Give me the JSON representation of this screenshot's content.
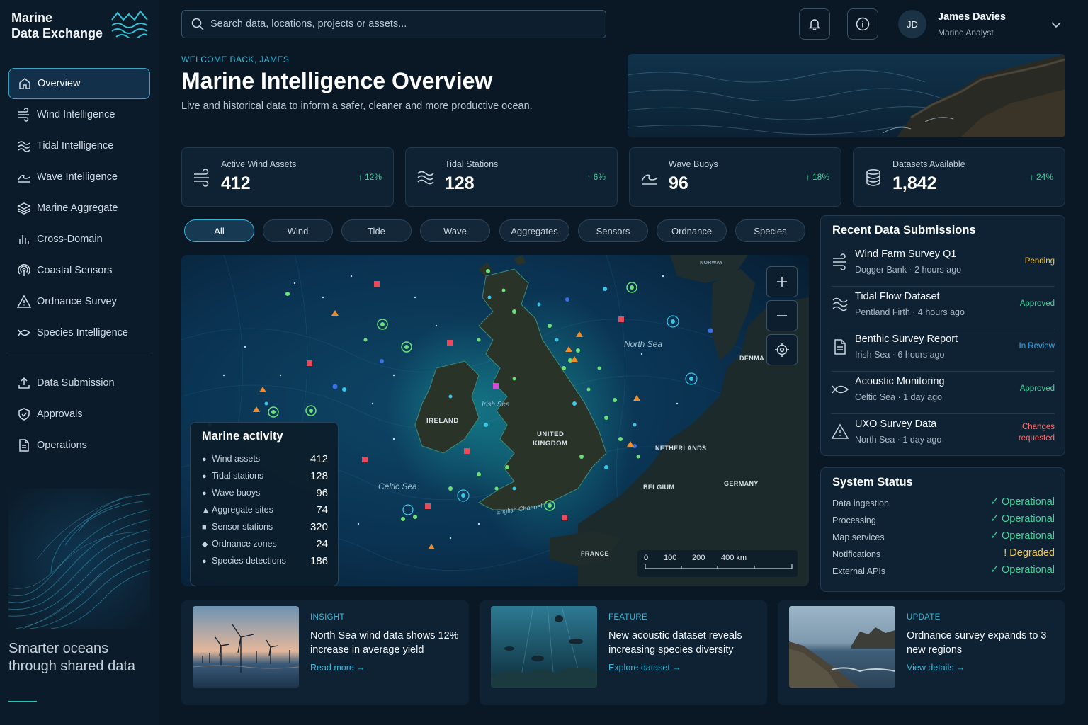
{
  "app": {
    "name_line1": "Marine",
    "name_line2": "Data Exchange"
  },
  "sidebar": {
    "items": [
      {
        "label": "Overview",
        "icon": "home-icon",
        "active": true
      },
      {
        "label": "Wind Intelligence",
        "icon": "wind-icon"
      },
      {
        "label": "Tidal Intelligence",
        "icon": "waves-icon"
      },
      {
        "label": "Wave Intelligence",
        "icon": "wave-icon"
      },
      {
        "label": "Marine Aggregate",
        "icon": "layers-icon"
      },
      {
        "label": "Cross-Domain",
        "icon": "bar-chart-icon"
      },
      {
        "label": "Coastal Sensors",
        "icon": "antenna-icon"
      },
      {
        "label": "Ordnance Survey",
        "icon": "warning-icon"
      },
      {
        "label": "Species Intelligence",
        "icon": "fish-icon"
      }
    ],
    "secondary": [
      {
        "label": "Data Submission",
        "icon": "upload-icon"
      },
      {
        "label": "Approvals",
        "icon": "shield-check-icon"
      },
      {
        "label": "Operations",
        "icon": "document-icon"
      }
    ],
    "tagline": "Smarter oceans through shared data"
  },
  "topbar": {
    "search_placeholder": "Search data, locations, projects or assets...",
    "user_initials": "JD",
    "user_name": "James Davies",
    "user_role": "Marine Analyst"
  },
  "hero": {
    "welcome": "WELCOME BACK, JAMES",
    "title": "Marine Intelligence Overview",
    "subtitle": "Live and historical data to inform a safer, cleaner and more productive ocean."
  },
  "stats": [
    {
      "label": "Active Wind Assets",
      "value": "412",
      "delta": "↑ 12%",
      "icon": "wind-icon"
    },
    {
      "label": "Tidal Stations",
      "value": "128",
      "delta": "↑ 6%",
      "icon": "waves-icon"
    },
    {
      "label": "Wave Buoys",
      "value": "96",
      "delta": "↑ 18%",
      "icon": "wave-icon"
    },
    {
      "label": "Datasets Available",
      "value": "1,842",
      "delta": "↑ 24%",
      "icon": "database-icon"
    }
  ],
  "filters": [
    "All",
    "Wind",
    "Tide",
    "Wave",
    "Aggregates",
    "Sensors",
    "Ordnance",
    "Species"
  ],
  "map": {
    "labels": {
      "north_sea": "North Sea",
      "irish_sea": "Irish Sea",
      "celtic_sea": "Celtic Sea",
      "english_channel": "English Channel",
      "ireland": "IRELAND",
      "uk1": "UNITED",
      "uk2": "KINGDOM",
      "netherlands": "NETHERLANDS",
      "belgium": "BELGIUM",
      "germany": "GERMANY",
      "france": "FRANCE",
      "denmark": "DENMA",
      "norway": "NORWAY"
    },
    "scale": [
      "0",
      "100",
      "200",
      "400 km"
    ]
  },
  "legend": {
    "title": "Marine activity",
    "rows": [
      {
        "symbol": "●",
        "label": "Wind assets",
        "value": "412"
      },
      {
        "symbol": "●",
        "label": "Tidal stations",
        "value": "128"
      },
      {
        "symbol": "●",
        "label": "Wave buoys",
        "value": "96"
      },
      {
        "symbol": "▲",
        "label": "Aggregate sites",
        "value": "74"
      },
      {
        "symbol": "■",
        "label": "Sensor stations",
        "value": "320"
      },
      {
        "symbol": "◆",
        "label": "Ordnance zones",
        "value": "24"
      },
      {
        "symbol": "●",
        "label": "Species detections",
        "value": "186"
      }
    ]
  },
  "submissions": {
    "title": "Recent Data Submissions",
    "rows": [
      {
        "name": "Wind Farm Survey Q1",
        "meta": "Dogger Bank · 2 hours ago",
        "status": "Pending",
        "color": "#f2c94c",
        "icon": "wind-icon"
      },
      {
        "name": "Tidal Flow Dataset",
        "meta": "Pentland Firth · 4 hours ago",
        "status": "Approved",
        "color": "#3ed39b",
        "icon": "waves-icon"
      },
      {
        "name": "Benthic Survey Report",
        "meta": "Irish Sea · 6 hours ago",
        "status": "In Review",
        "color": "#3ba9e6",
        "icon": "document-icon"
      },
      {
        "name": "Acoustic Monitoring",
        "meta": "Celtic Sea · 1 day ago",
        "status": "Approved",
        "color": "#3ed39b",
        "icon": "fish-icon"
      },
      {
        "name": "UXO Survey Data",
        "meta": "North Sea · 1 day ago",
        "status": "Changes requested",
        "color": "#ff6b6b",
        "icon": "warning-icon"
      }
    ]
  },
  "system": {
    "title": "System Status",
    "rows": [
      {
        "name": "Data ingestion",
        "status": "✓ Operational",
        "color": "#3ed39b"
      },
      {
        "name": "Processing",
        "status": "✓ Operational",
        "color": "#3ed39b"
      },
      {
        "name": "Map services",
        "status": "✓ Operational",
        "color": "#3ed39b"
      },
      {
        "name": "Notifications",
        "status": "! Degraded",
        "color": "#f2c94c"
      },
      {
        "name": "External APIs",
        "status": "✓ Operational",
        "color": "#3ed39b"
      }
    ]
  },
  "news": [
    {
      "tag": "INSIGHT",
      "title": "North Sea wind data shows 12% increase in average yield",
      "link": "Read more →"
    },
    {
      "tag": "FEATURE",
      "title": "New acoustic dataset reveals increasing species diversity",
      "link": "Explore dataset →"
    },
    {
      "tag": "UPDATE",
      "title": "Ordnance survey expands to 3 new regions",
      "link": "View details →"
    }
  ]
}
